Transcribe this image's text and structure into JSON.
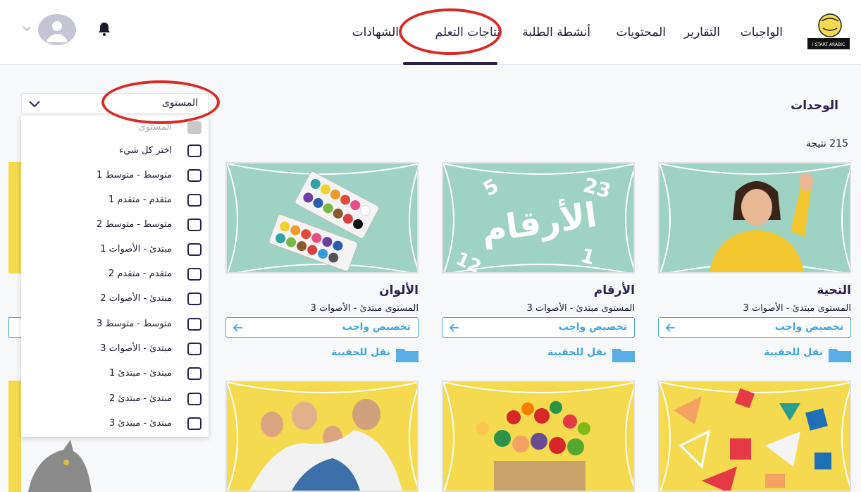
{
  "nav": {
    "items": [
      {
        "label": "الواجبات",
        "active": false
      },
      {
        "label": "التقارير",
        "active": false
      },
      {
        "label": "المحتويات",
        "active": false
      },
      {
        "label": "أنشطة الطلبة",
        "active": false
      },
      {
        "label": "نتاجات التعلم",
        "active": true
      },
      {
        "label": "الشهادات",
        "active": false
      }
    ],
    "logo_text": "I START ARABIC"
  },
  "page": {
    "section_title": "الوحدات",
    "result_count": "215 نتيجة"
  },
  "filter": {
    "selected_label": "المستوى",
    "options": [
      {
        "label": "المستوى",
        "disabled": true
      },
      {
        "label": "اختر كل شيء",
        "disabled": false
      },
      {
        "label": "متوسط - متوسط 1",
        "disabled": false
      },
      {
        "label": "متقدم - متقدم 1",
        "disabled": false
      },
      {
        "label": "متوسط - متوسط 2",
        "disabled": false
      },
      {
        "label": "مبتدئ - الأصوات 1",
        "disabled": false
      },
      {
        "label": "متقدم - متقدم 2",
        "disabled": false
      },
      {
        "label": "مبتدئ - الأصوات 2",
        "disabled": false
      },
      {
        "label": "متوسط - متوسط 3",
        "disabled": false
      },
      {
        "label": "مبتدئ - الأصوات 3",
        "disabled": false
      },
      {
        "label": "مبتدئ - مبتدئ 1",
        "disabled": false
      },
      {
        "label": "مبتدئ - مبتدئ 2",
        "disabled": false
      },
      {
        "label": "مبتدئ - مبتدئ 3",
        "disabled": false
      }
    ]
  },
  "cards": [
    {
      "title": "التحية",
      "level": "المستوى  مبتدئ - الأصوات 3",
      "assign_label": "تخصيص واجب",
      "move_label": "نقل للحقيبة",
      "image": "girl-waving"
    },
    {
      "title": "الأرقام",
      "level": "المستوى  مبتدئ - الأصوات 3",
      "assign_label": "تخصيص واجب",
      "move_label": "نقل للحقيبة",
      "image": "numbers",
      "image_text": {
        "word": "الأرقام",
        "n1": "5",
        "n2": "23",
        "n3": "12",
        "n4": "1"
      }
    },
    {
      "title": "الألوان",
      "level": "المستوى  مبتدئ - الأصوات 3",
      "assign_label": "تخصيص واجب",
      "move_label": "نقل للحقيبة",
      "image": "paint-palettes"
    }
  ],
  "colors": {
    "primary": "#2a1f4d",
    "accent": "#3ea3e8",
    "card_green": "#9ed3c4",
    "card_yellow": "#f5d94e",
    "annotation_red": "#d92a25"
  }
}
